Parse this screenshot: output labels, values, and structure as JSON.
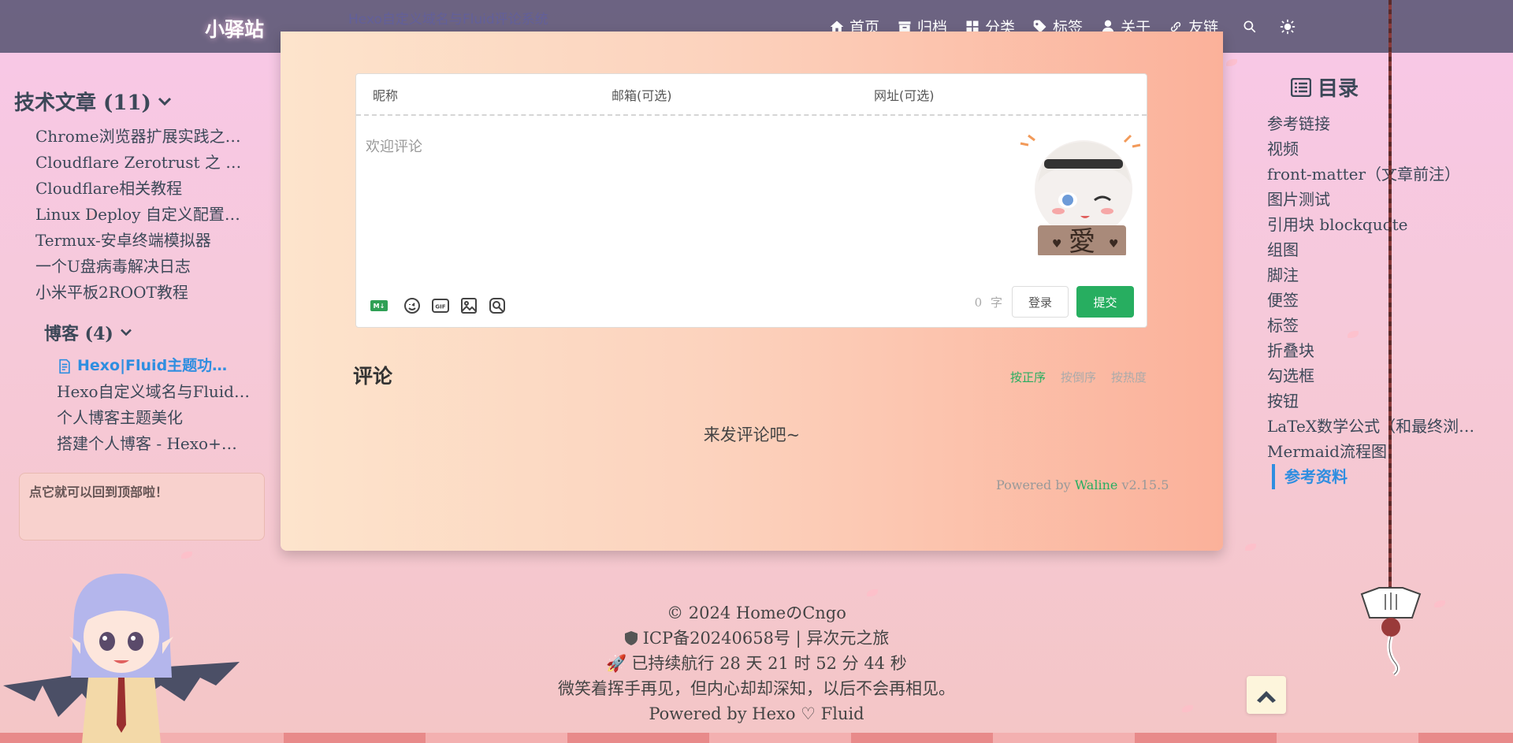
{
  "navbar": {
    "brand": "小驿站",
    "ghost_title": "Hexo自定义域名与Fluid评论系统",
    "items": [
      {
        "label": "首页",
        "icon": "home-icon"
      },
      {
        "label": "归档",
        "icon": "archive-icon"
      },
      {
        "label": "分类",
        "icon": "category-icon"
      },
      {
        "label": "标签",
        "icon": "tag-icon"
      },
      {
        "label": "关于",
        "icon": "user-icon"
      },
      {
        "label": "友链",
        "icon": "link-icon"
      }
    ],
    "search_icon": "search-icon",
    "theme_icon": "sun-icon"
  },
  "sidebar": {
    "category_title": "技术文章 (11)",
    "category_items": [
      "Chrome浏览器扩展实践之Chrome插件开发",
      "Cloudflare Zerotrust 之 WARP",
      "Cloudflare相关教程",
      "Linux Deploy 自定义配置 Ubuntu",
      "Termux-安卓终端模拟器",
      "一个U盘病毒解决日志",
      "小米平板2ROOT教程"
    ],
    "subcategory_title": "博客 (4)",
    "subcategory_items": [
      "Hexo|Fluid主题功能测试",
      "Hexo自定义域名与Fluid评论系统",
      "个人博客主题美化",
      "搭建个人博客 - Hexo+Matery"
    ],
    "active_index": 0,
    "tip": "点它就可以回到顶部啦！"
  },
  "comment_form": {
    "nick_placeholder": "昵称",
    "mail_placeholder": "邮箱(可选)",
    "link_placeholder": "网址(可选)",
    "textarea_placeholder": "欢迎评论",
    "md_badge": "M↓",
    "word_count": "0",
    "word_unit": "字",
    "login_label": "登录",
    "submit_label": "提交"
  },
  "comments": {
    "title": "评论",
    "sort_options": [
      "按正序",
      "按倒序",
      "按热度"
    ],
    "active_sort": 0,
    "empty_message": "来发评论吧~",
    "powered_prefix": "Powered by",
    "powered_name": "Waline",
    "powered_version": "v2.15.5"
  },
  "toc": {
    "title": "目录",
    "items": [
      "参考链接",
      "视频",
      "front-matter（文章前注）",
      "图片测试",
      "引用块 blockquote",
      "组图",
      "脚注",
      "便签",
      "标签",
      "折叠块",
      "勾选框",
      "按钮",
      "LaTeX数学公式（和最终浏览效果）",
      "Mermaid流程图",
      "参考资料"
    ],
    "active_index": 14
  },
  "footer": {
    "copyright": "© 2024 HomeのCngo",
    "icp": "ICP备20240658号 | 异次元之旅",
    "runtime": "已持续航行 28 天 21 时 52 分 44 秒",
    "quote": "微笑着挥手再见，但内心却却深知，以后不会再相见。",
    "powered": "Powered by Hexo ♡ Fluid"
  },
  "colors": {
    "accent_blue": "#2f8ee0",
    "accent_green": "#27ae60",
    "navbar": "#605a78"
  }
}
